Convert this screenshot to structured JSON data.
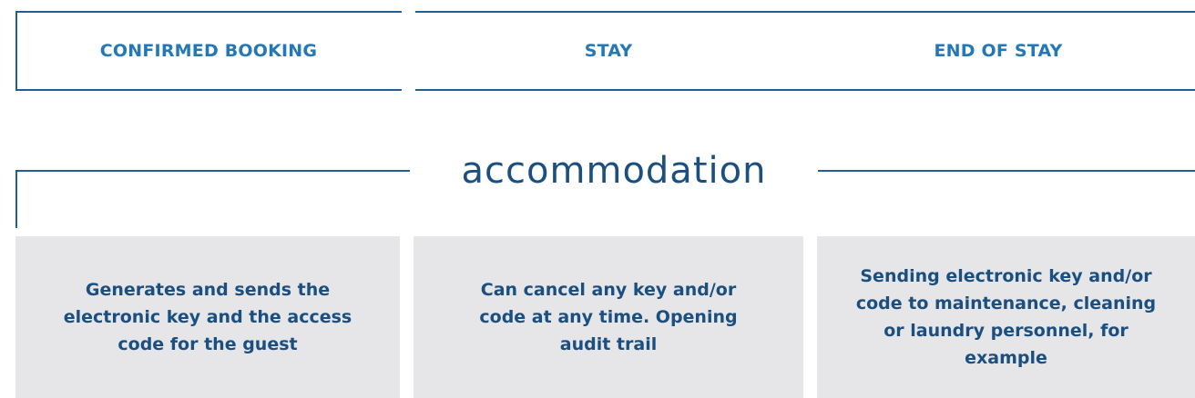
{
  "phases": [
    {
      "label": "CONFIRMED BOOKING"
    },
    {
      "label": "STAY"
    },
    {
      "label": "END OF STAY"
    }
  ],
  "section": {
    "title": "accommodation"
  },
  "cards": [
    {
      "text": "Generates and sends the electronic key and the access code for the guest"
    },
    {
      "text": "Can cancel any key and/or code at any time. Opening audit trail"
    },
    {
      "text": "Sending electronic key and/or code to maintenance, cleaning or laundry personnel, for example"
    }
  ],
  "colors": {
    "line": "#1f5f96",
    "phase_text": "#2478b8",
    "body_text": "#1b4f80",
    "card_bg": "#e6e5e7"
  }
}
